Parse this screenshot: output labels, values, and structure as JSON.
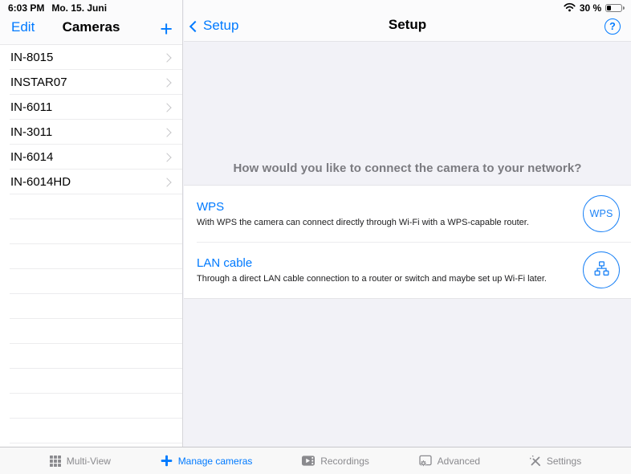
{
  "status_bar": {
    "time": "6:03 PM",
    "date": "Mo. 15. Juni",
    "battery_percent": "30 %"
  },
  "sidebar": {
    "edit_button": "Edit",
    "title": "Cameras",
    "add_button": "+",
    "cameras": [
      "IN-8015",
      "INSTAR07",
      "IN-6011",
      "IN-3011",
      "IN-6014",
      "IN-6014HD"
    ]
  },
  "setup_panel": {
    "back_button": "Setup",
    "title": "Setup",
    "help_button": "?",
    "question": "How would you like to connect the camera to your network?",
    "options": [
      {
        "title": "WPS",
        "description": "With WPS the camera can connect directly through Wi-Fi with a WPS-capable router.",
        "button_label": "WPS",
        "icon": "wps-circle-button"
      },
      {
        "title": "LAN cable",
        "description": "Through a direct LAN cable connection to a router or switch and maybe set up Wi-Fi later.",
        "icon": "lan-network-icon"
      }
    ]
  },
  "tab_bar": {
    "tabs": [
      {
        "label": "Multi-View",
        "icon": "grid-icon",
        "active": false
      },
      {
        "label": "Manage cameras",
        "icon": "plus-icon",
        "active": true
      },
      {
        "label": "Recordings",
        "icon": "film-icon",
        "active": false
      },
      {
        "label": "Advanced",
        "icon": "window-gear-icon",
        "active": false
      },
      {
        "label": "Settings",
        "icon": "tools-icon",
        "active": false
      }
    ]
  },
  "colors": {
    "accent_blue": "#007aff",
    "circle_blue": "#1d83f6",
    "inactive_gray": "#8a8a8e",
    "grouped_background": "#f2f2f7",
    "panel_white": "#ffffff"
  }
}
